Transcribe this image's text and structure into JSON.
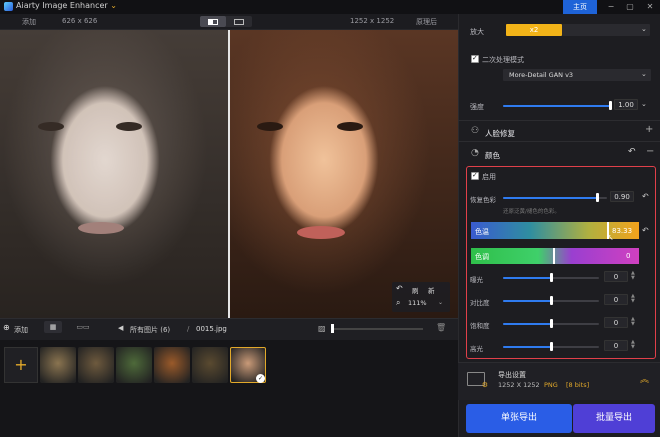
{
  "app": {
    "title": "Aiarty Image Enhancer",
    "home_label": "主页"
  },
  "view": {
    "left_label": "添加",
    "left_res": "626 x 626",
    "right_res": "1252 x 1252",
    "right_label": "原理后"
  },
  "zoom": {
    "undo": "↶",
    "mid": "刷",
    "redo": "新",
    "level": "111%"
  },
  "bottom": {
    "add_label": "添加",
    "crumb_root": "所有图片 (6)",
    "crumb_sep": "/",
    "crumb_file": "0015.jpg"
  },
  "thumbnails": [
    {
      "name": "tiger",
      "color": "#8a7450"
    },
    {
      "name": "tiger-2",
      "color": "#6e5a3e"
    },
    {
      "name": "temple",
      "color": "#4e6a3a"
    },
    {
      "name": "food",
      "color": "#9a5a2a"
    },
    {
      "name": "dragon",
      "color": "#5a4a30"
    },
    {
      "name": "portrait",
      "color": "#c99a78"
    }
  ],
  "panel": {
    "scale_label": "放大",
    "scale_value": "x2",
    "second_pass_label": "二次处理模式",
    "model_value": "More-Detail GAN  v3",
    "strength_label": "强度",
    "strength_value": "1.00",
    "strength_fraction": 1.0,
    "face_label": "人脸修复",
    "color_label": "颜色",
    "enable_label": "启用",
    "restore_label": "恢复色彩",
    "restore_value": "0.90",
    "restore_fraction": 0.9,
    "restore_hint": "还原泛黄/褪色的色彩。",
    "temp_label": "色温",
    "temp_value": "83.33",
    "tint_label": "色调",
    "tint_value": "0",
    "sliders": [
      {
        "label": "曝光",
        "value": "0"
      },
      {
        "label": "对比度",
        "value": "0"
      },
      {
        "label": "饱和度",
        "value": "0"
      },
      {
        "label": "高光",
        "value": "0"
      }
    ],
    "export_title": "导出设置",
    "export_res": "1252 X 1252",
    "export_fmt": "PNG",
    "export_bits": "[8 bits]",
    "single_export": "单张导出",
    "batch_export": "批量导出"
  },
  "colors": {
    "accent": "#2f7bf0",
    "home": "#1e63d8",
    "scale": "#f2b318",
    "frame": "#e0404a"
  }
}
